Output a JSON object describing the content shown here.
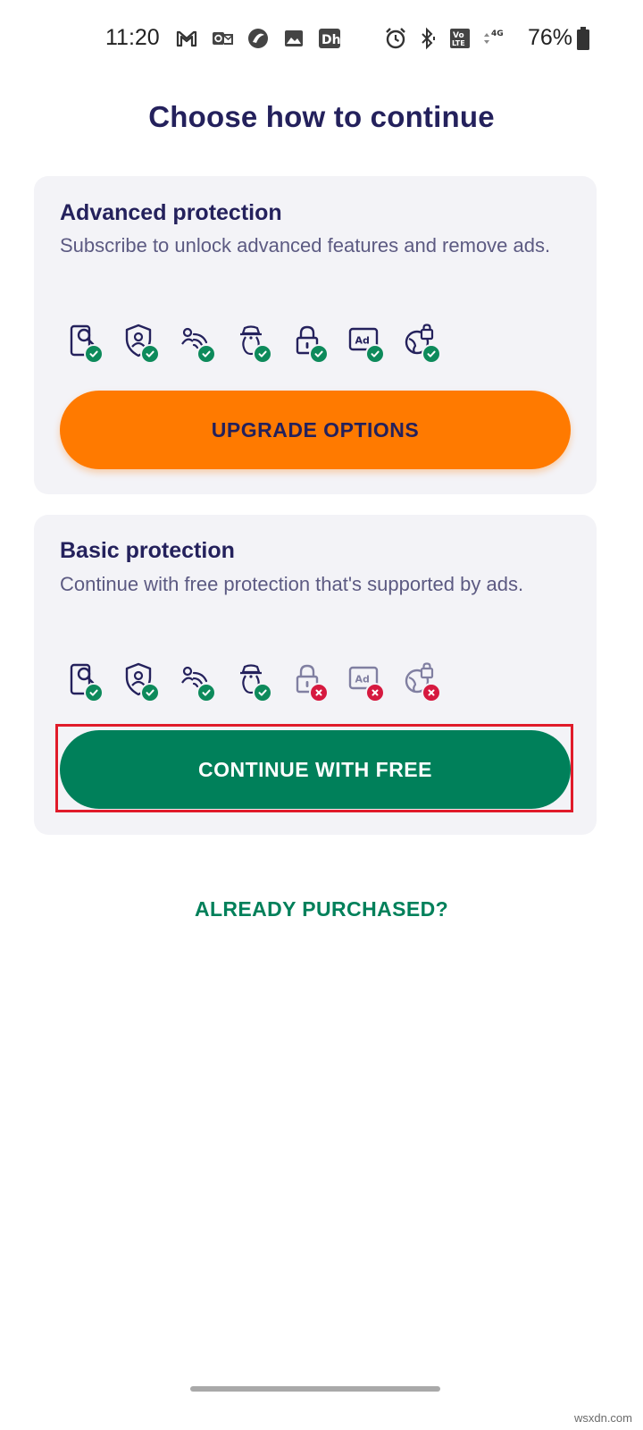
{
  "status_bar": {
    "time": "11:20",
    "battery_percent": "76%",
    "left_icons": [
      "gmail-icon",
      "outlook-icon",
      "app-icon",
      "gallery-icon",
      "hotstar-icon"
    ],
    "right_icons": [
      "alarm-icon",
      "bluetooth-icon",
      "volte-icon",
      "4g-signal-icon"
    ]
  },
  "page": {
    "title": "Choose how to continue"
  },
  "advanced": {
    "title": "Advanced protection",
    "description": "Subscribe to unlock advanced features and remove ads.",
    "features": [
      {
        "icon": "phone-scan-icon",
        "included": true
      },
      {
        "icon": "identity-shield-icon",
        "included": true
      },
      {
        "icon": "wifi-security-icon",
        "included": true
      },
      {
        "icon": "anti-theft-icon",
        "included": true
      },
      {
        "icon": "app-lock-icon",
        "included": true
      },
      {
        "icon": "no-ads-icon",
        "included": true
      },
      {
        "icon": "vpn-lock-icon",
        "included": true
      }
    ],
    "button_label": "UPGRADE OPTIONS"
  },
  "basic": {
    "title": "Basic protection",
    "description": "Continue with free protection that's supported by ads.",
    "features": [
      {
        "icon": "phone-scan-icon",
        "included": true
      },
      {
        "icon": "identity-shield-icon",
        "included": true
      },
      {
        "icon": "wifi-security-icon",
        "included": true
      },
      {
        "icon": "anti-theft-icon",
        "included": true
      },
      {
        "icon": "app-lock-icon",
        "included": false
      },
      {
        "icon": "no-ads-icon",
        "included": false
      },
      {
        "icon": "vpn-lock-icon",
        "included": false
      }
    ],
    "button_label": "CONTINUE WITH FREE"
  },
  "footer": {
    "link_label": "ALREADY PURCHASED?"
  },
  "watermark": "wsxdn.com",
  "colors": {
    "title": "#24215c",
    "upgrade_button": "#ff7a00",
    "free_button": "#00805a",
    "included_badge": "#0d8a5b",
    "excluded_badge": "#d6193f",
    "highlight_frame": "#e01b2a"
  }
}
